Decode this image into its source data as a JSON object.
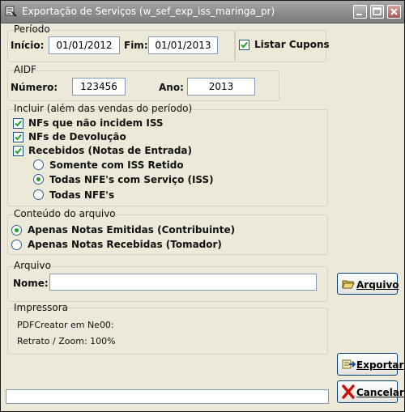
{
  "window": {
    "title": "Exportação de Serviços (w_sef_exp_iss_maringa_pr)"
  },
  "periodo": {
    "legend": "Período",
    "inicio_label": "Início:",
    "inicio_value": "01/01/2012",
    "fim_label": "Fim:",
    "fim_value": "01/01/2013",
    "listar_cupons_label": "Listar Cupons",
    "listar_cupons_checked": true
  },
  "aidf": {
    "legend": "AIDF",
    "numero_label": "Número:",
    "numero_value": "123456",
    "ano_label": "Ano:",
    "ano_value": "2013"
  },
  "incluir": {
    "legend": "Incluir (além das vendas do período)",
    "checkboxes": [
      {
        "label": "NFs que não incidem ISS",
        "checked": true
      },
      {
        "label": "NFs de Devolução",
        "checked": true
      },
      {
        "label": "Recebidos (Notas de Entrada)",
        "checked": true
      }
    ],
    "radios": [
      {
        "label": "Somente com ISS Retido",
        "selected": false
      },
      {
        "label": "Todas NFE's com Serviço (ISS)",
        "selected": true
      },
      {
        "label": "Todas NFE's",
        "selected": false
      }
    ]
  },
  "conteudo": {
    "legend": "Conteúdo do arquivo",
    "radios": [
      {
        "label": "Apenas Notas Emitidas (Contribuinte)",
        "selected": true
      },
      {
        "label": "Apenas Notas Recebidas (Tomador)",
        "selected": false
      }
    ]
  },
  "arquivo": {
    "legend": "Arquivo",
    "nome_label": "Nome:",
    "nome_value": "",
    "button_label": "Arquivo"
  },
  "impressora": {
    "legend": "Impressora",
    "line1": "PDFCreator em Ne00:",
    "line2": "Retrato / Zoom: 100%"
  },
  "buttons": {
    "exportar": "Exportar",
    "cancelar": "Cancelar"
  },
  "icons": {
    "app": "app-icon",
    "minimize": "minimize-icon",
    "maximize": "maximize-icon",
    "close": "close-icon",
    "folder": "folder-open-icon",
    "export": "export-icon",
    "cancel": "cancel-x-icon"
  },
  "colors": {
    "titlebar": "#8e8e8e",
    "dialog_bg": "#ece9d8",
    "field_border": "#7f9db9",
    "check_mark": "#21a121",
    "cancel_x": "#cc1111"
  }
}
